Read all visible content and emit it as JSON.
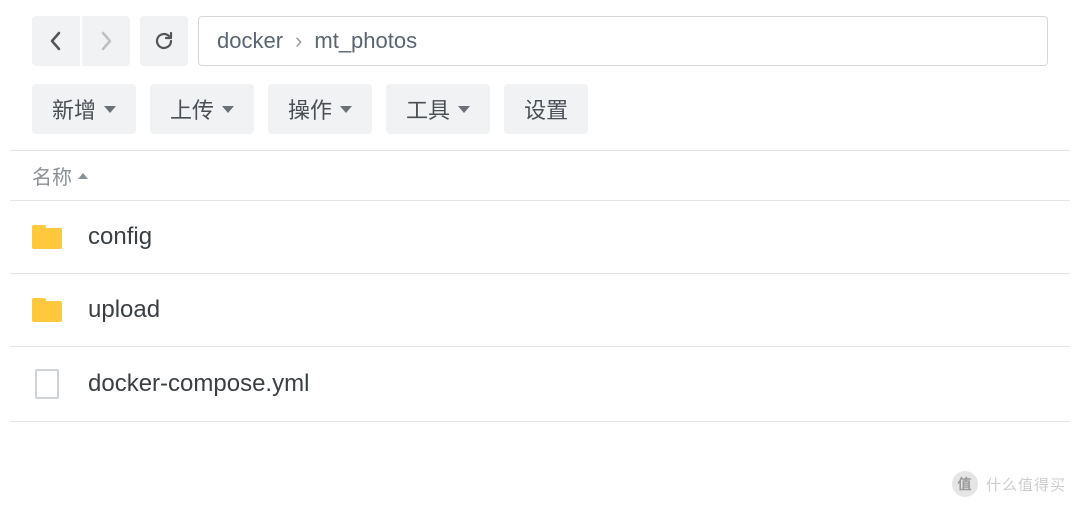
{
  "nav": {
    "breadcrumb": [
      "docker",
      "mt_photos"
    ]
  },
  "toolbar": {
    "new_label": "新增",
    "upload_label": "上传",
    "action_label": "操作",
    "tools_label": "工具",
    "settings_label": "设置"
  },
  "columns": {
    "name": "名称"
  },
  "files": [
    {
      "name": "config",
      "type": "folder"
    },
    {
      "name": "upload",
      "type": "folder"
    },
    {
      "name": "docker-compose.yml",
      "type": "file"
    }
  ],
  "watermark": {
    "badge": "值",
    "text": "什么值得买"
  }
}
